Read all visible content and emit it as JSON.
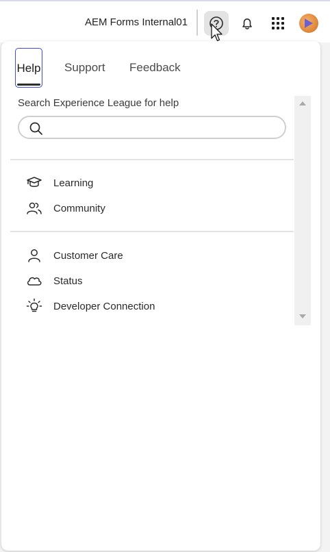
{
  "topbar": {
    "org_name": "AEM Forms Internal01",
    "icons": [
      "help-icon",
      "bell-icon",
      "apps-grid-icon",
      "avatar"
    ]
  },
  "tabs": [
    {
      "label": "Help",
      "active": true
    },
    {
      "label": "Support",
      "active": false
    },
    {
      "label": "Feedback",
      "active": false
    }
  ],
  "search": {
    "label": "Search Experience League for help",
    "value": "",
    "placeholder": ""
  },
  "group1": [
    {
      "label": "Learning",
      "icon": "graduation-cap-icon"
    },
    {
      "label": "Community",
      "icon": "people-icon"
    }
  ],
  "group2": [
    {
      "label": "Customer Care",
      "icon": "person-icon"
    },
    {
      "label": "Status",
      "icon": "cloud-icon"
    },
    {
      "label": "Developer Connection",
      "icon": "lightbulb-icon"
    }
  ],
  "colors": {
    "accent": "#3b4bd8",
    "active_underline": "#2c2c2c"
  }
}
